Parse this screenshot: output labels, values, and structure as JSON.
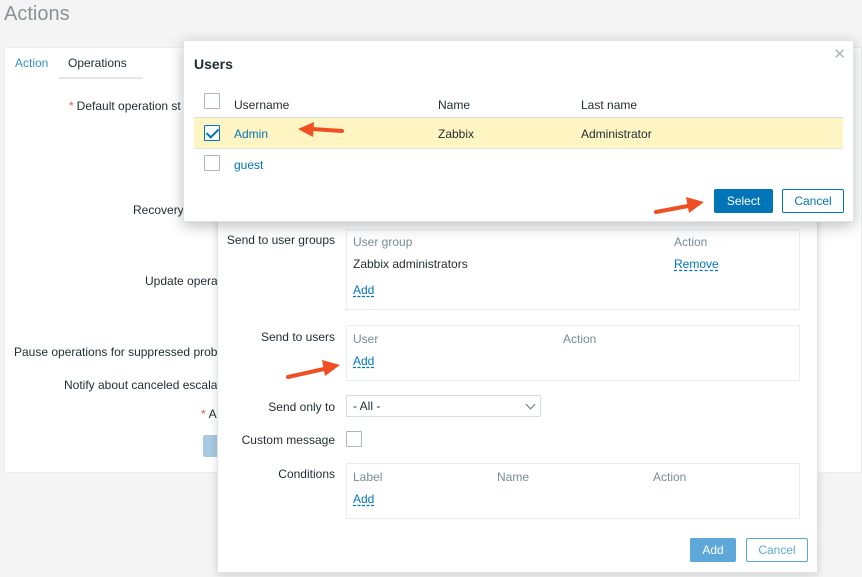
{
  "page": {
    "title": "Actions"
  },
  "tabs": [
    {
      "label": "Action"
    },
    {
      "label": "Operations"
    }
  ],
  "background_form": {
    "default_operation_step": "Default operation st",
    "recovery": "Recovery",
    "update_operations": "Update opera",
    "pause_suppressed": "Pause operations for suppressed prob",
    "notify_canceled": "Notify about canceled escala",
    "required_stub": "A"
  },
  "operation_dialog": {
    "send_to_user_groups": {
      "label": "Send to user groups",
      "col_group": "User group",
      "col_action": "Action",
      "rows": [
        {
          "group": "Zabbix administrators",
          "action": "Remove"
        }
      ],
      "add": "Add"
    },
    "send_to_users": {
      "label": "Send to users",
      "col_user": "User",
      "col_action": "Action",
      "add": "Add"
    },
    "send_only_to": {
      "label": "Send only to",
      "value": "- All -"
    },
    "custom_message": {
      "label": "Custom message",
      "checked": false
    },
    "conditions": {
      "label": "Conditions",
      "col_label": "Label",
      "col_name": "Name",
      "col_action": "Action",
      "add": "Add"
    },
    "buttons": {
      "add": "Add",
      "cancel": "Cancel"
    }
  },
  "users_dialog": {
    "title": "Users",
    "close_icon": "close-icon",
    "columns": {
      "username": "Username",
      "name": "Name",
      "last_name": "Last name"
    },
    "rows": [
      {
        "username": "Admin",
        "name": "Zabbix",
        "last_name": "Administrator",
        "checked": true
      },
      {
        "username": "guest",
        "name": "",
        "last_name": "",
        "checked": false
      }
    ],
    "buttons": {
      "select": "Select",
      "cancel": "Cancel"
    }
  },
  "colors": {
    "accent": "#0275b8",
    "highlight_row": "#fef5c2",
    "annotation_arrow": "#f04e23"
  }
}
